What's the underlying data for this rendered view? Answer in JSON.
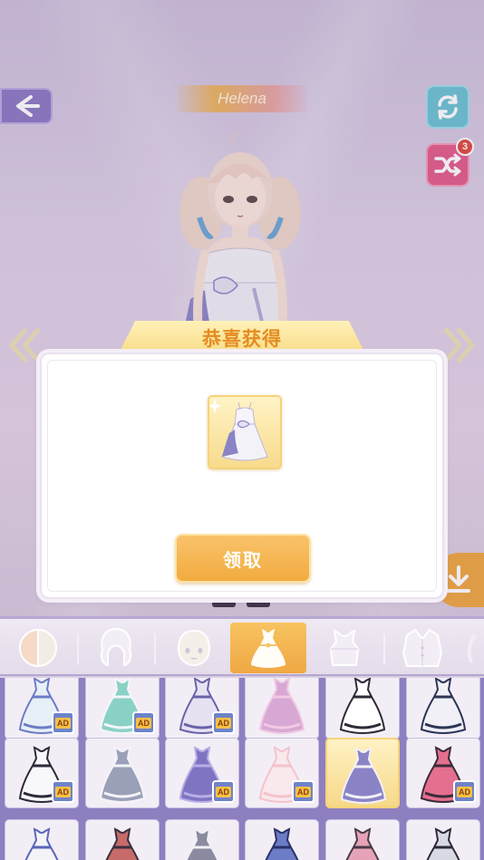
{
  "header": {
    "character_name": "Helena",
    "shuffle_badge_count": "3",
    "back_icon": "back-arrow-icon",
    "refresh_icon": "refresh-icon",
    "shuffle_icon": "shuffle-icon"
  },
  "modal": {
    "title": "恭喜获得",
    "reward_item": "white-dress-icon",
    "claim_label": "领取"
  },
  "categories": [
    {
      "name": "skin",
      "icon": "skin-tone-icon",
      "active": false
    },
    {
      "name": "hair",
      "icon": "hair-icon",
      "active": false
    },
    {
      "name": "face",
      "icon": "face-icon",
      "active": false
    },
    {
      "name": "dress",
      "icon": "dress-icon",
      "active": true
    },
    {
      "name": "top",
      "icon": "top-icon",
      "active": false
    },
    {
      "name": "coat",
      "icon": "coat-icon",
      "active": false
    }
  ],
  "items": {
    "ad_label": "AD",
    "rows": [
      [
        {
          "ad": true
        },
        {
          "ad": true
        },
        {
          "ad": true
        },
        {
          "ad": false
        },
        {
          "ad": false
        },
        {
          "ad": false
        }
      ],
      [
        {
          "ad": true
        },
        {
          "ad": false
        },
        {
          "ad": true
        },
        {
          "ad": true
        },
        {
          "ad": false,
          "selected": true
        },
        {
          "ad": true
        }
      ],
      [
        {
          "ad": false
        },
        {
          "ad": false
        },
        {
          "ad": false
        },
        {
          "ad": false
        },
        {
          "ad": false
        },
        {
          "ad": false
        }
      ]
    ]
  },
  "colors": {
    "accent_gold": "#f2ab3f",
    "purple": "#8e7fc0",
    "teal": "#6bc2d4",
    "pink": "#e35b8a"
  }
}
